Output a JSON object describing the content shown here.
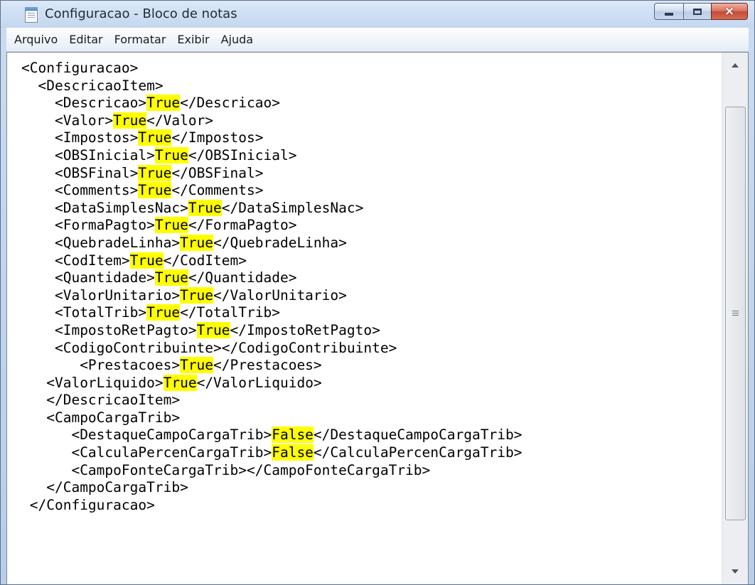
{
  "window": {
    "title": "Configuracao - Bloco de notas",
    "icon": "notepad-icon",
    "controls": {
      "minimize": "minimize-icon",
      "maximize": "maximize-icon",
      "close_glyph": "×"
    }
  },
  "menubar": {
    "items": [
      {
        "label": "Arquivo"
      },
      {
        "label": "Editar"
      },
      {
        "label": "Formatar"
      },
      {
        "label": "Exibir"
      },
      {
        "label": "Ajuda"
      }
    ]
  },
  "editor": {
    "highlight_color": "#ffff00",
    "lines": [
      {
        "indent": 0,
        "pre": "<Configuracao>",
        "hl": "",
        "post": ""
      },
      {
        "indent": 2,
        "pre": "<DescricaoItem>",
        "hl": "",
        "post": ""
      },
      {
        "indent": 4,
        "pre": "<Descricao>",
        "hl": "True",
        "post": "</Descricao>"
      },
      {
        "indent": 4,
        "pre": "<Valor>",
        "hl": "True",
        "post": "</Valor>"
      },
      {
        "indent": 4,
        "pre": "<Impostos>",
        "hl": "True",
        "post": "</Impostos>"
      },
      {
        "indent": 4,
        "pre": "<OBSInicial>",
        "hl": "True",
        "post": "</OBSInicial>"
      },
      {
        "indent": 4,
        "pre": "<OBSFinal>",
        "hl": "True",
        "post": "</OBSFinal>"
      },
      {
        "indent": 4,
        "pre": "<Comments>",
        "hl": "True",
        "post": "</Comments>"
      },
      {
        "indent": 4,
        "pre": "<DataSimplesNac>",
        "hl": "True",
        "post": "</DataSimplesNac>"
      },
      {
        "indent": 4,
        "pre": "<FormaPagto>",
        "hl": "True",
        "post": "</FormaPagto>"
      },
      {
        "indent": 4,
        "pre": "<QuebradeLinha>",
        "hl": "True",
        "post": "</QuebradeLinha>"
      },
      {
        "indent": 4,
        "pre": "<CodItem>",
        "hl": "True",
        "post": "</CodItem>"
      },
      {
        "indent": 4,
        "pre": "<Quantidade>",
        "hl": "True",
        "post": "</Quantidade>"
      },
      {
        "indent": 4,
        "pre": "<ValorUnitario>",
        "hl": "True",
        "post": "</ValorUnitario>"
      },
      {
        "indent": 4,
        "pre": "<TotalTrib>",
        "hl": "True",
        "post": "</TotalTrib>"
      },
      {
        "indent": 4,
        "pre": "<ImpostoRetPagto>",
        "hl": "True",
        "post": "</ImpostoRetPagto>"
      },
      {
        "indent": 4,
        "pre": "<CodigoContribuinte></CodigoContribuinte>",
        "hl": "",
        "post": ""
      },
      {
        "indent": 7,
        "pre": "<Prestacoes>",
        "hl": "True",
        "post": "</Prestacoes>"
      },
      {
        "indent": 3,
        "pre": "<ValorLiquido>",
        "hl": "True",
        "post": "</ValorLiquido>"
      },
      {
        "indent": 3,
        "pre": "</DescricaoItem>",
        "hl": "",
        "post": ""
      },
      {
        "indent": 3,
        "pre": "<CampoCargaTrib>",
        "hl": "",
        "post": ""
      },
      {
        "indent": 6,
        "pre": "<DestaqueCampoCargaTrib>",
        "hl": "False",
        "post": "</DestaqueCampoCargaTrib>"
      },
      {
        "indent": 6,
        "pre": "<CalculaPercenCargaTrib>",
        "hl": "False",
        "post": "</CalculaPercenCargaTrib>"
      },
      {
        "indent": 6,
        "pre": "<CampoFonteCargaTrib></CampoFonteCargaTrib>",
        "hl": "",
        "post": ""
      },
      {
        "indent": 3,
        "pre": "</CampoCargaTrib>",
        "hl": "",
        "post": ""
      },
      {
        "indent": 1,
        "pre": "</Configuracao>",
        "hl": "",
        "post": ""
      }
    ]
  },
  "scrollbar": {
    "up_icon": "scroll-up-arrow-icon",
    "down_icon": "scroll-down-arrow-icon",
    "grip_icon": "grip-icon"
  }
}
